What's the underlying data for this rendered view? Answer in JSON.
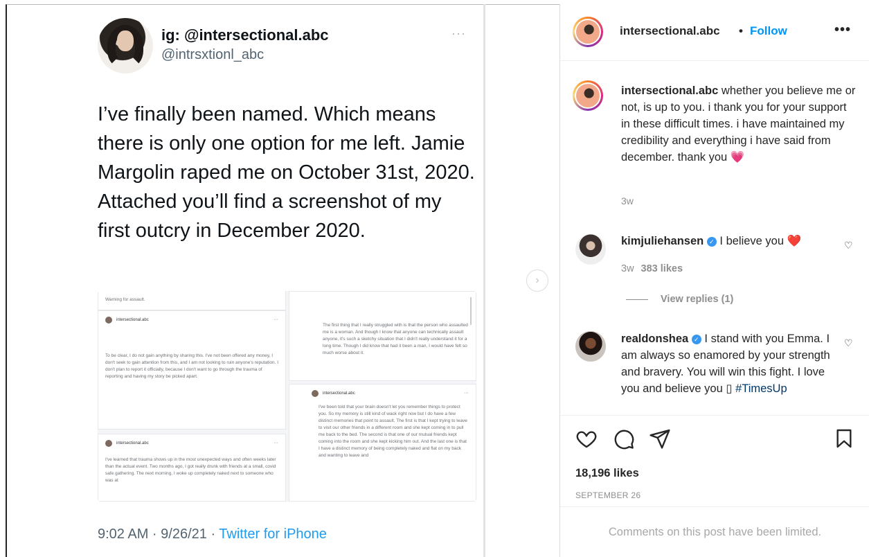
{
  "tweet": {
    "display_name": "ig: @intersectional.abc",
    "handle": "@intrsxtionl_abc",
    "more_icon": "ellipsis-icon",
    "text": "I’ve finally been named. Which means there is only one option for me left. Jamie Margolin raped me on October 31st, 2020. Attached you’ll find a screenshot of my first outcry in December 2020.",
    "timestamp": "9:02 AM · 9/26/21 · ",
    "source": "Twitter for iPhone",
    "media_panels": [
      {
        "username": "",
        "text": "Warning for assault."
      },
      {
        "username": "intersectional.abc",
        "text": "To be clear, I do not gain anything by sharing this. I've not been offered any money, I don't seek to gain attention from this, and I am not looking to ruin anyone's reputation. I don't plan to report it officially, because I don't want to go through the trauma of reporting and having my story be picked apart."
      },
      {
        "username": "intersectional.abc",
        "text": "I've learned that trauma shows up in the most unexpected ways and often weeks later than the actual event. Two months ago, I got really drunk with friends at a small, covid safe gathering. The next morning, I woke up completely naked next to someone who was at"
      },
      {
        "username": "",
        "text": "The first thing that I really struggled with is that the person who assaulted me is a woman. And though I know that anyone can technically assault anyone, it's such a sketchy situation that I didn't really understand it for a long time. Though I did know that had it been a man, I would have felt so much worse about it."
      },
      {
        "username": "intersectional.abc",
        "text": "I've been told that your brain doesn't let you remember things to protect you. So my memory is still kind of wack right now but I do have a few distinct memories that point to assault. The first is that I kept trying to leave to visit our other friends in a different room and she kept coming in to pull me back to the bed. The second is that one of our mutual friends kept coming into the room and she kept kicking him out. And the last one is that I have a distinct memory of being completely naked and flat on my back and wanting to leave and"
      }
    ]
  },
  "carousel": {
    "next_icon": "chevron-right-icon"
  },
  "instagram": {
    "header": {
      "username": "intersectional.abc",
      "separator": "•",
      "follow_label": "Follow",
      "more_label": "•••"
    },
    "caption": {
      "username": "intersectional.abc",
      "text": " whether you believe me or not, is up to you. i thank you for your support in these difficult times. i have maintained my credibility and everything i have said from december. thank you 💗",
      "time": "3w"
    },
    "comments": [
      {
        "username": "kimjuliehansen",
        "verified": true,
        "text": " I believe you ❤️",
        "time": "3w",
        "likes": "383 likes",
        "view_replies": "View replies (1)"
      },
      {
        "username": "realdonshea",
        "verified": true,
        "text": " I stand with you Emma. I am always so enamored by your strength and bravery. You will win this fight. I love you and believe you ",
        "missing_glyph": "▯",
        "hashtag": "#TimesUp"
      }
    ],
    "likes": "18,196 likes",
    "date": "SEPTEMBER 26",
    "limited_notice": "Comments on this post have been limited.",
    "verified_glyph": "✓",
    "small_heart": "♡"
  },
  "colors": {
    "ig_blue": "#0095f6",
    "twitter_blue": "#1d9bf0",
    "verified": "#3897f0",
    "muted": "#8e8e8e"
  }
}
